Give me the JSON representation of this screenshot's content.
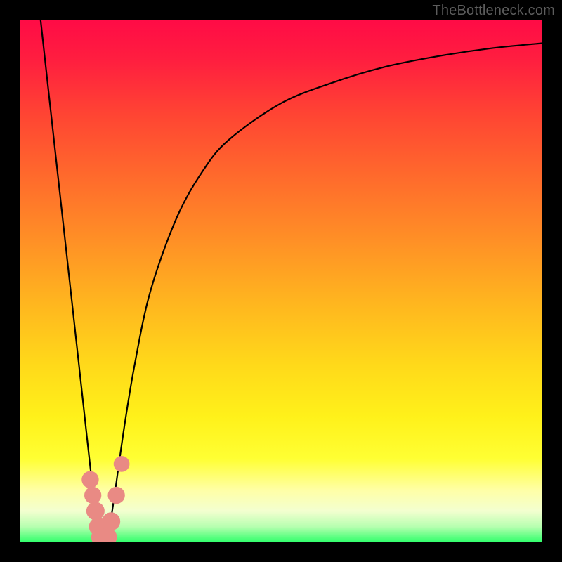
{
  "attribution": "TheBottleneck.com",
  "chart_data": {
    "type": "line",
    "title": "",
    "xlabel": "",
    "ylabel": "",
    "xlim": [
      0,
      100
    ],
    "ylim": [
      0,
      100
    ],
    "series": [
      {
        "name": "bottleneck-curve",
        "x": [
          4,
          6,
          8,
          10,
          12,
          14,
          15,
          16,
          17,
          18,
          20,
          22,
          25,
          30,
          35,
          40,
          50,
          60,
          70,
          80,
          90,
          100
        ],
        "y": [
          100,
          82,
          64,
          46,
          28,
          10,
          2,
          0,
          2,
          8,
          22,
          34,
          48,
          62,
          71,
          77,
          84,
          88,
          91,
          93,
          94.5,
          95.5
        ]
      }
    ],
    "markers": {
      "name": "highlighted-points",
      "color": "#e98a84",
      "points": [
        {
          "x": 13.5,
          "y": 12,
          "r": 2.0
        },
        {
          "x": 14.0,
          "y": 9,
          "r": 2.0
        },
        {
          "x": 14.5,
          "y": 6,
          "r": 2.2
        },
        {
          "x": 15.0,
          "y": 3,
          "r": 2.2
        },
        {
          "x": 15.5,
          "y": 1,
          "r": 2.3
        },
        {
          "x": 16.0,
          "y": 0,
          "r": 2.3
        },
        {
          "x": 16.8,
          "y": 1,
          "r": 2.3
        },
        {
          "x": 17.5,
          "y": 4,
          "r": 2.2
        },
        {
          "x": 18.5,
          "y": 9,
          "r": 2.0
        },
        {
          "x": 19.5,
          "y": 15,
          "r": 1.8
        }
      ]
    },
    "background_gradient": {
      "direction": "vertical",
      "stops": [
        {
          "pos": 0.0,
          "color": "#ff0b46"
        },
        {
          "pos": 0.3,
          "color": "#ff6a2c"
        },
        {
          "pos": 0.66,
          "color": "#ffd91a"
        },
        {
          "pos": 0.9,
          "color": "#ffffa6"
        },
        {
          "pos": 1.0,
          "color": "#2eff6a"
        }
      ]
    }
  }
}
